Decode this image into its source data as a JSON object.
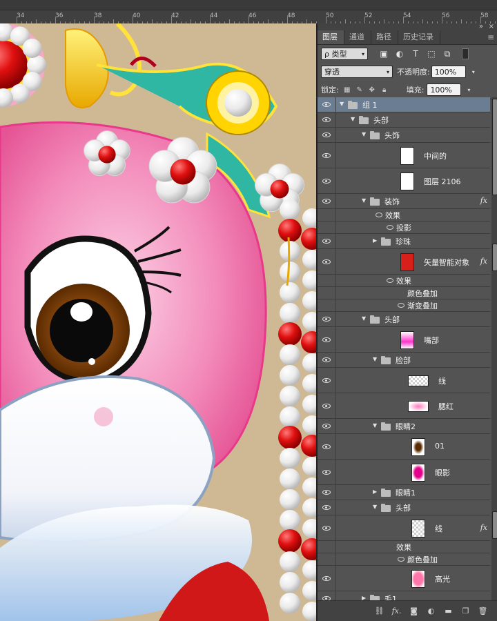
{
  "ruler": {
    "labels": [
      "34",
      "36",
      "38",
      "40",
      "42",
      "44",
      "46",
      "48",
      "50",
      "52",
      "54",
      "56",
      "58"
    ]
  },
  "panel": {
    "tabs": [
      {
        "label": "图层",
        "active": true
      },
      {
        "label": "通道",
        "active": false
      },
      {
        "label": "路径",
        "active": false
      },
      {
        "label": "历史记录",
        "active": false
      }
    ],
    "filter_label": "ρ 类型",
    "blend_mode": "穿透",
    "opacity_label": "不透明度:",
    "opacity_value": "100%",
    "lock_label": "锁定:",
    "fill_label": "填充:",
    "fill_value": "100%",
    "menu_icon": "panel-menu-icon",
    "collapse_icon": "double-chevron-icon",
    "close_icon": "close-icon"
  },
  "layers": [
    {
      "name": "组 1",
      "kind": "group",
      "indent": 0,
      "expanded": true,
      "selected": true,
      "fx": false
    },
    {
      "name": "头部",
      "kind": "group",
      "indent": 1,
      "expanded": true,
      "fx": false
    },
    {
      "name": "头饰",
      "kind": "group",
      "indent": 2,
      "expanded": true,
      "fx": false
    },
    {
      "name": "中间的",
      "kind": "layer",
      "indent": 3,
      "fx": false
    },
    {
      "name": "图层 2106",
      "kind": "layer",
      "indent": 3,
      "fx": false
    },
    {
      "name": "装饰",
      "kind": "group",
      "indent": 2,
      "expanded": true,
      "fx": true
    },
    {
      "name": "效果",
      "kind": "effect-head",
      "indent": 3
    },
    {
      "name": "投影",
      "kind": "effect",
      "indent": 4
    },
    {
      "name": "珍珠",
      "kind": "group",
      "indent": 3,
      "expanded": false,
      "fx": false
    },
    {
      "name": "矢量智能对象",
      "kind": "layer",
      "indent": 3,
      "fx": true
    },
    {
      "name": "效果",
      "kind": "effect-head",
      "indent": 4
    },
    {
      "name": "颜色叠加",
      "kind": "effect-noeye",
      "indent": 5
    },
    {
      "name": "渐变叠加",
      "kind": "effect",
      "indent": 5
    },
    {
      "name": "头部",
      "kind": "group",
      "indent": 2,
      "expanded": true,
      "fx": false
    },
    {
      "name": "嘴部",
      "kind": "layer",
      "indent": 3,
      "fx": false
    },
    {
      "name": "脸部",
      "kind": "group",
      "indent": 3,
      "expanded": true,
      "fx": false
    },
    {
      "name": "线",
      "kind": "layer",
      "indent": 4,
      "fx": false
    },
    {
      "name": "腮红",
      "kind": "layer",
      "indent": 4,
      "fx": false
    },
    {
      "name": "眼睛2",
      "kind": "group",
      "indent": 3,
      "expanded": true,
      "fx": false
    },
    {
      "name": "01",
      "kind": "layer",
      "indent": 4,
      "fx": false
    },
    {
      "name": "眼影",
      "kind": "layer",
      "indent": 4,
      "fx": false
    },
    {
      "name": "眼睛1",
      "kind": "group",
      "indent": 3,
      "expanded": false,
      "fx": false
    },
    {
      "name": "头部",
      "kind": "group",
      "indent": 3,
      "expanded": true,
      "fx": false
    },
    {
      "name": "线",
      "kind": "layer",
      "indent": 4,
      "fx": true
    },
    {
      "name": "效果",
      "kind": "effect-head-noeye",
      "indent": 4
    },
    {
      "name": "颜色叠加",
      "kind": "effect",
      "indent": 5
    },
    {
      "name": "高光",
      "kind": "layer",
      "indent": 4,
      "fx": false
    },
    {
      "name": "毛1",
      "kind": "group",
      "indent": 2,
      "expanded": false,
      "fx": false
    }
  ],
  "bottom_bar": [
    "link-icon",
    "fx-icon",
    "mask-icon",
    "adjustment-icon",
    "folder-icon",
    "new-layer-icon",
    "trash-icon"
  ],
  "colors": {
    "selected_row": "#6b7d93",
    "panel_bg": "#535353",
    "canvas_bg": "#cfb894",
    "pink": "#ec72a8"
  }
}
